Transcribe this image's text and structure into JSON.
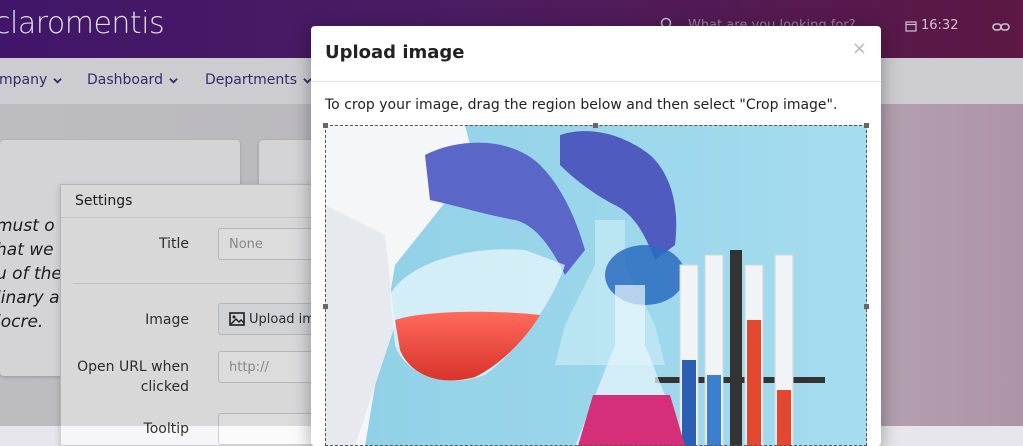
{
  "header": {
    "logo_text": "claromentis",
    "search_placeholder": "What are you looking for?",
    "time": "16:32"
  },
  "nav": {
    "items": [
      {
        "label": "mpany"
      },
      {
        "label": "Dashboard"
      },
      {
        "label": "Departments"
      }
    ]
  },
  "background": {
    "quote_lines": [
      "must o",
      "hat we ",
      "u of the",
      "linary a",
      "iocre."
    ]
  },
  "settings": {
    "title": "Settings",
    "title_label": "Title",
    "title_placeholder": "None",
    "image_label": "Image",
    "upload_button": "Upload im",
    "url_label_line1": "Open URL when",
    "url_label_line2": "clicked",
    "url_placeholder": "http://",
    "tooltip_label": "Tooltip"
  },
  "modal": {
    "title": "Upload image",
    "close": "×",
    "instructions": "To crop your image, drag the region below and then select \"Crop image\"."
  },
  "colors": {
    "brand_gradient_start": "#4a1a79",
    "brand_gradient_end": "#6a1c4d",
    "nav_text": "#3f2f78"
  }
}
